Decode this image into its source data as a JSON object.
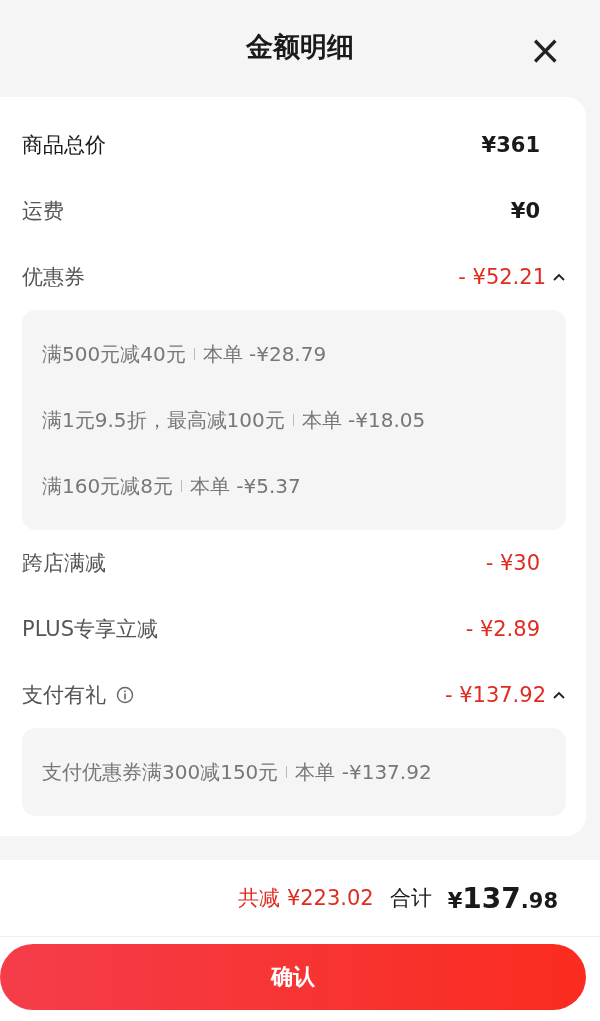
{
  "header": {
    "title": "金额明细",
    "close_icon": "×"
  },
  "rows": [
    {
      "kind": "total",
      "label": "商品总价",
      "amount": "¥361",
      "info": false
    },
    {
      "kind": "fee",
      "label": "运费",
      "amount": "¥0",
      "info": false
    },
    {
      "kind": "discount",
      "label": "优惠券",
      "amount": "- ¥52.21",
      "info": false,
      "expanded": true,
      "details": [
        {
          "condition": "满500元减40元",
          "saving": "本单 -¥28.79"
        },
        {
          "condition": "满1元9.5折，最高减100元",
          "saving": "本单 -¥18.05"
        },
        {
          "condition": "满160元减8元",
          "saving": "本单 -¥5.37"
        }
      ]
    },
    {
      "kind": "discount",
      "label": "跨店满减",
      "amount": "- ¥30",
      "info": false
    },
    {
      "kind": "discount",
      "label": "PLUS专享立减",
      "amount": "- ¥2.89",
      "info": false
    },
    {
      "kind": "discount",
      "label": "支付有礼",
      "amount": "- ¥137.92",
      "info": true,
      "expanded": true,
      "details": [
        {
          "condition": "支付优惠券满300减150元",
          "saving": "本单 -¥137.92"
        }
      ]
    }
  ],
  "summary": {
    "saved_label": "共减",
    "saved_amount": "¥223.02",
    "total_label": "合计",
    "total_currency": "¥",
    "total_integer": "137",
    "total_decimal": ".98"
  },
  "confirm_button": "确认"
}
